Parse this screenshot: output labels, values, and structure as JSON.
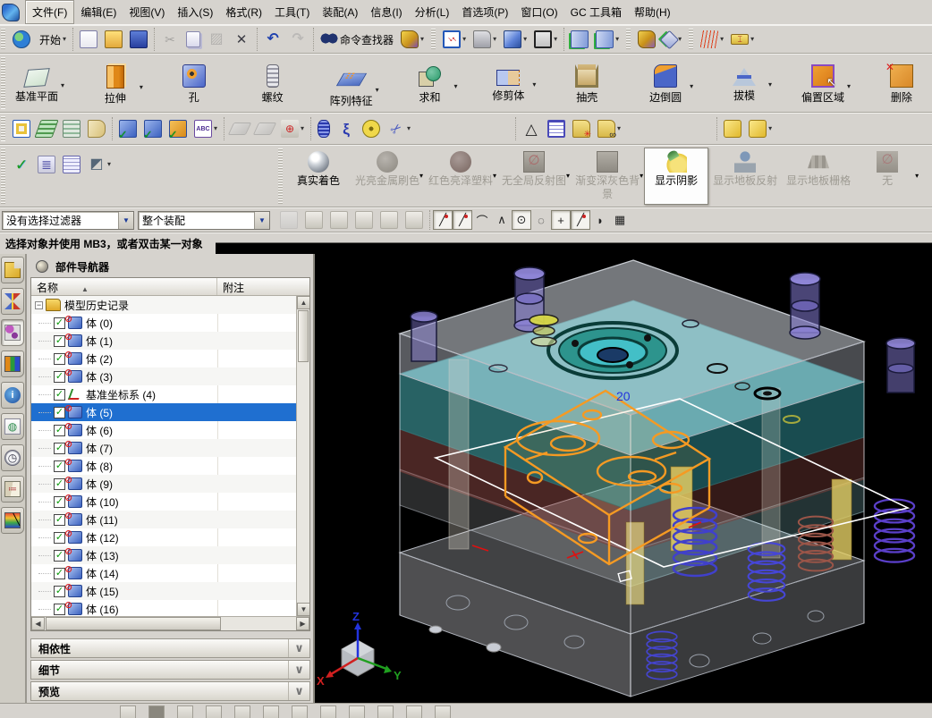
{
  "menu": {
    "items": [
      {
        "label": "文件(F)",
        "state": "first"
      },
      {
        "label": "编辑(E)"
      },
      {
        "label": "视图(V)"
      },
      {
        "label": "插入(S)"
      },
      {
        "label": "格式(R)"
      },
      {
        "label": "工具(T)"
      },
      {
        "label": "装配(A)"
      },
      {
        "label": "信息(I)"
      },
      {
        "label": "分析(L)"
      },
      {
        "label": "首选项(P)"
      },
      {
        "label": "窗口(O)"
      },
      {
        "label": "GC 工具箱"
      },
      {
        "label": "帮助(H)"
      }
    ]
  },
  "toolbars": {
    "standard": {
      "groups": [
        {
          "items": [
            {
              "icon": "nx-logo"
            },
            {
              "icon": "start-menu",
              "label": "开始",
              "dropdown": "dd"
            }
          ]
        },
        {
          "items": [
            {
              "icon": "new-file"
            },
            {
              "icon": "open-folder"
            },
            {
              "icon": "save"
            }
          ]
        },
        {
          "items": [
            {
              "icon": "cut",
              "state": "disabled"
            },
            {
              "icon": "copy"
            },
            {
              "icon": "paste",
              "state": "disabled"
            },
            {
              "icon": "delete"
            }
          ]
        },
        {
          "items": [
            {
              "icon": "undo"
            },
            {
              "icon": "redo",
              "state": "disabled"
            }
          ]
        },
        {
          "items": [
            {
              "icon": "command-finder",
              "label": "命令查找器"
            },
            {
              "icon": "role-palette",
              "dropdown": "dd"
            }
          ]
        },
        {
          "items": [
            {
              "icon": "fit-view",
              "dropdown": "dd"
            },
            {
              "icon": "print",
              "dropdown": "dd"
            },
            {
              "icon": "shaded-view",
              "dropdown": "dd"
            },
            {
              "icon": "wireframe-view",
              "dropdown": "dd"
            }
          ]
        },
        {
          "items": [
            {
              "icon": "clip-section"
            },
            {
              "icon": "clip-section-2",
              "dropdown": "dd"
            }
          ]
        },
        {
          "items": [
            {
              "icon": "edit-object-display"
            },
            {
              "icon": "show-hide",
              "dropdown": "dd"
            }
          ]
        },
        {
          "items": [
            {
              "icon": "pmi",
              "dropdown": "dd"
            },
            {
              "icon": "measure",
              "dropdown": "dd"
            }
          ]
        }
      ]
    },
    "feature": {
      "items": [
        {
          "label": "基准平面",
          "icon": "datum-plane",
          "dropdown": "dd"
        },
        {
          "label": "拉伸",
          "icon": "extrude",
          "dropdown": "dd"
        },
        {
          "label": "孔",
          "icon": "hole"
        },
        {
          "label": "螺纹",
          "icon": "thread"
        },
        {
          "label": "阵列特征",
          "icon": "pattern",
          "dropdown": "dd"
        },
        {
          "label": "求和",
          "icon": "unite",
          "dropdown": "dd"
        },
        {
          "label": "修剪体",
          "icon": "trim-body",
          "dropdown": "dd"
        },
        {
          "label": "抽壳",
          "icon": "shell"
        },
        {
          "label": "边倒圆",
          "icon": "edge-blend",
          "dropdown": "dd"
        },
        {
          "label": "拔模",
          "icon": "draft",
          "dropdown": "dd"
        },
        {
          "label": "偏置区域",
          "icon": "offset-region",
          "dropdown": "dd"
        },
        {
          "label": "删除",
          "icon": "delete-face"
        }
      ]
    },
    "utility": {
      "groups": [
        {
          "items": [
            {
              "icon": "select-bar"
            },
            {
              "icon": "layer-stack"
            },
            {
              "icon": "layer-settings"
            },
            {
              "icon": "tag-note"
            }
          ]
        },
        {
          "items": [
            {
              "icon": "approve-body"
            },
            {
              "icon": "approve-tool"
            },
            {
              "icon": "approve-cube"
            },
            {
              "icon": "abc-annotate",
              "dropdown": "dd"
            }
          ]
        },
        {
          "items": [
            {
              "icon": "gray-part-1",
              "state": "disabled"
            },
            {
              "icon": "gray-part-2",
              "state": "disabled"
            },
            {
              "icon": "measure-hand",
              "dropdown": "dd"
            }
          ]
        },
        {
          "items": [
            {
              "icon": "spring-coil"
            },
            {
              "icon": "spring-ext"
            },
            {
              "icon": "washer"
            },
            {
              "icon": "spring-cut",
              "dropdown": "dd"
            }
          ]
        },
        {
          "items": [
            {
              "icon": "triangle"
            },
            {
              "icon": "grid-table"
            },
            {
              "icon": "folder-points"
            },
            {
              "icon": "folder-circles",
              "dropdown": "dd"
            }
          ]
        },
        {
          "items": [
            {
              "icon": "assembly-lock-1"
            },
            {
              "icon": "assembly-lock-2",
              "dropdown": "dd"
            }
          ]
        }
      ]
    },
    "view_left": {
      "items": [
        {
          "icon": "verify-screw"
        },
        {
          "icon": "screw-list"
        },
        {
          "icon": "table-screw"
        },
        {
          "icon": "orient-view",
          "dropdown": "dd"
        }
      ]
    },
    "render": {
      "items": [
        {
          "label": "真实着色",
          "icon": "sphere-shiny"
        },
        {
          "label": "光亮金属刷色",
          "icon": "sphere-gray",
          "state": "disabled",
          "dropdown": "dd"
        },
        {
          "label": "红色亮泽塑料",
          "icon": "sphere-dark",
          "state": "disabled",
          "dropdown": "dd"
        },
        {
          "label": "无全局反射图",
          "icon": "square-none",
          "state": "disabled",
          "dropdown": "dd"
        },
        {
          "label": "渐变深灰色背\n景",
          "icon": "square-bg",
          "state": "disabled",
          "dropdown": "dd"
        },
        {
          "label": "显示阴影",
          "icon": "lamp",
          "state": "active"
        },
        {
          "label": "显示地板反射",
          "icon": "floor-reflect",
          "state": "disabled"
        },
        {
          "label": "显示地板栅格",
          "icon": "floor-grid",
          "state": "disabled"
        },
        {
          "label": "无",
          "icon": "none-flat",
          "state": "disabled",
          "dropdown": "dd"
        }
      ]
    },
    "snap_pre": {
      "items": [
        {
          "icon": "general-selection",
          "state": "disabled"
        },
        {
          "icon": "select-arrows"
        },
        {
          "icon": "deselect-target"
        },
        {
          "icon": "select-hand"
        },
        {
          "icon": "highlight-box"
        },
        {
          "icon": "clip-box"
        }
      ]
    },
    "snap": {
      "items": [
        {
          "glyph": "╱",
          "icon": "end-point",
          "state": "pressed",
          "dot": "dot"
        },
        {
          "glyph": "╱",
          "icon": "mid-point",
          "state": "pressed",
          "dot": "dot"
        },
        {
          "glyph": "⌒",
          "icon": "control-point"
        },
        {
          "glyph": "∧",
          "icon": "intersection-point"
        },
        {
          "glyph": "⊙",
          "icon": "arc-center",
          "state": "pressed"
        },
        {
          "glyph": "◌",
          "icon": "quadrant-point"
        },
        {
          "glyph": "+",
          "icon": "existing-point",
          "state": "pressed"
        },
        {
          "glyph": "╱",
          "icon": "point-on-curve",
          "state": "pressed",
          "dot": "dot"
        },
        {
          "glyph": "◗",
          "icon": "point-on-face"
        },
        {
          "glyph": "▦",
          "icon": "snap-grid"
        }
      ]
    }
  },
  "selection_bar": {
    "filter_value": "没有选择过滤器",
    "scope_value": "整个装配"
  },
  "status_bar": {
    "cue": "选择对象并使用 MB3，或者双击某一对象"
  },
  "resource_bar": {
    "items": [
      {
        "icon": "assembly-navigator"
      },
      {
        "icon": "constraint-navigator"
      },
      {
        "icon": "part-navigator",
        "state": "active"
      },
      {
        "icon": "reuse-library"
      },
      {
        "icon": "hd3d-tool"
      },
      {
        "icon": "web-browser"
      },
      {
        "icon": "history"
      },
      {
        "icon": "system-materials"
      },
      {
        "icon": "visual-reports"
      }
    ]
  },
  "navigator": {
    "title": "部件导航器",
    "columns": {
      "name": "名称",
      "note": "附注"
    },
    "root_label": "模型历史记录",
    "items": [
      {
        "name": "体 (0)",
        "icon": "body"
      },
      {
        "name": "体 (1)",
        "icon": "body"
      },
      {
        "name": "体 (2)",
        "icon": "body"
      },
      {
        "name": "体 (3)",
        "icon": "body"
      },
      {
        "name": "基准坐标系 (4)",
        "icon": "csys"
      },
      {
        "name": "体 (5)",
        "icon": "body",
        "state": "selected"
      },
      {
        "name": "体 (6)",
        "icon": "body"
      },
      {
        "name": "体 (7)",
        "icon": "body"
      },
      {
        "name": "体 (8)",
        "icon": "body"
      },
      {
        "name": "体 (9)",
        "icon": "body"
      },
      {
        "name": "体 (10)",
        "icon": "body"
      },
      {
        "name": "体 (11)",
        "icon": "body"
      },
      {
        "name": "体 (12)",
        "icon": "body"
      },
      {
        "name": "体 (13)",
        "icon": "body"
      },
      {
        "name": "体 (14)",
        "icon": "body"
      },
      {
        "name": "体 (15)",
        "icon": "body"
      },
      {
        "name": "体 (16)",
        "icon": "body"
      }
    ],
    "panels": [
      {
        "label": "相依性"
      },
      {
        "label": "细节"
      },
      {
        "label": "预览"
      }
    ]
  },
  "viewport": {
    "dim_label": "20",
    "axes": {
      "x": "X",
      "y": "Y",
      "z": "Z"
    },
    "colors": {
      "selected_body": "#f59a23",
      "cavity_plate": "#45c8c8",
      "highlight": "#ffffff",
      "background": "#000000"
    }
  },
  "bottom_bar": {
    "items": [
      {
        "icon": "sketch-tool"
      },
      {
        "icon": "sketch-thumb",
        "state": "dark"
      },
      {
        "icon": "sketch-tool"
      },
      {
        "icon": "sketch-tool"
      },
      {
        "icon": "sketch-tool"
      },
      {
        "icon": "sketch-tool"
      },
      {
        "icon": "sketch-tool"
      },
      {
        "icon": "sketch-tool"
      },
      {
        "icon": "sketch-tool"
      },
      {
        "icon": "sketch-tool"
      },
      {
        "icon": "sketch-tool"
      },
      {
        "icon": "sketch-tool"
      }
    ]
  }
}
